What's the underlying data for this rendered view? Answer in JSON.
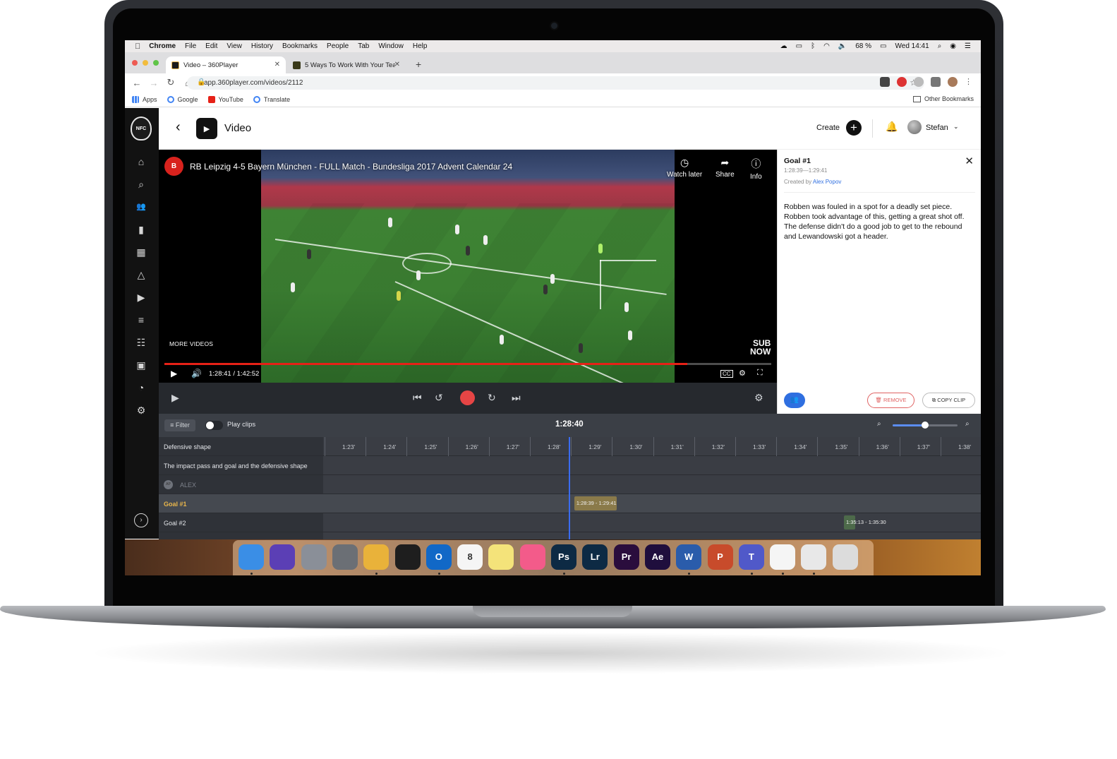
{
  "menubar": {
    "apple": "",
    "app": "Chrome",
    "items": [
      "File",
      "Edit",
      "View",
      "History",
      "Bookmarks",
      "People",
      "Tab",
      "Window",
      "Help"
    ],
    "battery": "68 %",
    "clock": "Wed 14:41"
  },
  "browser": {
    "tabs": [
      {
        "title": "Video – 360Player",
        "active": true
      },
      {
        "title": "5 Ways To Work With Your Tea",
        "active": false
      }
    ],
    "new_tab": "+",
    "url": "app.360player.com/videos/2112",
    "bookmarks": [
      "Apps",
      "Google",
      "YouTube",
      "Translate"
    ],
    "other_bookmarks": "Other Bookmarks"
  },
  "app": {
    "logo_text": "NFC",
    "page_title": "Video",
    "create_label": "Create",
    "user_name": "Stefan",
    "sidebar_icons": [
      "home-icon",
      "search-icon",
      "group-icon",
      "stats-icon",
      "calendar-icon",
      "drills-icon",
      "video-icon",
      "sliders-icon",
      "assessment-icon",
      "tactics-icon",
      "stopwatch-icon",
      "settings-icon"
    ]
  },
  "player": {
    "video_title": "RB Leipzig 4-5 Bayern München - FULL Match - Bundesliga 2017 Advent Calendar 24",
    "watch_later": "Watch later",
    "share": "Share",
    "info": "Info",
    "more_videos": "MORE VIDEOS",
    "sub_now_1": "SUB",
    "sub_now_2": "NOW",
    "time": "1:28:41 / 1:42:52",
    "progress_fraction": 0.862
  },
  "panel": {
    "title": "Goal #1",
    "range": "1:28:39—1:29:41",
    "created_by_prefix": "Created by",
    "author": "Alex Popov",
    "description": "Robben was fouled in a spot for a deadly set piece. Robben took advantage of this, getting a great shot off. The defense didn't do a good job to get to the rebound and Lewandowski got a header.",
    "remove_label": "REMOVE",
    "copy_label": "COPY CLIP"
  },
  "timeline": {
    "filter_label": "Filter",
    "play_clips_label": "Play clips",
    "current_time": "1:28:40",
    "zoom_level": 0.5,
    "ticks": [
      "1:23'",
      "1:24'",
      "1:25'",
      "1:26'",
      "1:27'",
      "1:28'",
      "1:29'",
      "1:30'",
      "1:31'",
      "1:32'",
      "1:33'",
      "1:34'",
      "1:35'",
      "1:36'",
      "1:37'",
      "1:38'"
    ],
    "rows": [
      {
        "label": "Defensive shape",
        "style": "normal"
      },
      {
        "label": "The impact pass and goal and the defensive shape",
        "style": "normal"
      },
      {
        "label": "ALEX",
        "style": "muted"
      },
      {
        "label": "Goal #1",
        "style": "gold"
      },
      {
        "label": "Goal #2",
        "style": "normal"
      }
    ],
    "clips": [
      {
        "row": 3,
        "label": "1:28:39 - 1:29:41",
        "start": "1:28:39",
        "end": "1:29:41",
        "color": "#8a7a4a"
      },
      {
        "row": 4,
        "label": "1:35:13 - 1:35:30",
        "start": "1:35:13",
        "end": "1:35:30",
        "color": "#4d6a4a"
      }
    ]
  },
  "dock": {
    "apps": [
      {
        "name": "finder-icon",
        "label": "",
        "color": "#3a8ee6"
      },
      {
        "name": "siri-icon",
        "label": "",
        "color": "#5b3fb5"
      },
      {
        "name": "launchpad-icon",
        "label": "",
        "color": "#8a8f98"
      },
      {
        "name": "system-preferences-icon",
        "label": "",
        "color": "#6b6f75"
      },
      {
        "name": "chrome-icon",
        "label": "",
        "color": "#e9b23a"
      },
      {
        "name": "figma-icon",
        "label": "",
        "color": "#1e1e1e"
      },
      {
        "name": "outlook-icon",
        "label": "O",
        "color": "#1168c7"
      },
      {
        "name": "calendar-icon",
        "label": "8",
        "color": "#f5f5f5"
      },
      {
        "name": "notes-icon",
        "label": "",
        "color": "#f4e37a"
      },
      {
        "name": "itunes-icon",
        "label": "",
        "color": "#f35b8a"
      },
      {
        "name": "photoshop-icon",
        "label": "Ps",
        "color": "#0d2a44"
      },
      {
        "name": "lightroom-icon",
        "label": "Lr",
        "color": "#0d2a44"
      },
      {
        "name": "premiere-icon",
        "label": "Pr",
        "color": "#2a0d3d"
      },
      {
        "name": "after-effects-icon",
        "label": "Ae",
        "color": "#1f0e3d"
      },
      {
        "name": "word-icon",
        "label": "W",
        "color": "#2a5cab"
      },
      {
        "name": "powerpoint-icon",
        "label": "P",
        "color": "#c84b2b"
      },
      {
        "name": "teams-icon",
        "label": "T",
        "color": "#5059c9"
      },
      {
        "name": "slack-icon",
        "label": "",
        "color": "#f5f5f5"
      },
      {
        "name": "preview-icon",
        "label": "",
        "color": "#e8e8e8"
      },
      {
        "name": "trash-icon",
        "label": "",
        "color": "#dcdcdc"
      }
    ]
  },
  "colors": {
    "accent": "#2f6fe0",
    "record": "#e64545",
    "yt_red": "#e62117",
    "gold": "#e9b64b",
    "sidebar": "#121212"
  }
}
